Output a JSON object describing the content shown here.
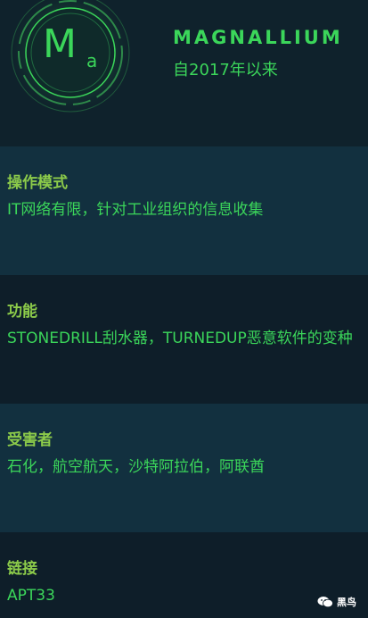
{
  "header": {
    "badge_symbol": "M",
    "badge_sub": "a",
    "name": "MAGNALLIUM",
    "since": "自2017年以来"
  },
  "sections": [
    {
      "label": "操作模式",
      "value": "IT网络有限，针对工业组织的信息收集"
    },
    {
      "label": "功能",
      "value": "STONEDRILL刮水器，TURNEDUP恶意软件的变种"
    },
    {
      "label": "受害者",
      "value": "石化，航空航天，沙特阿拉伯，阿联酋"
    },
    {
      "label": "链接",
      "value": "APT33"
    }
  ],
  "watermark": {
    "icon": "wechat-icon",
    "text": "黑鸟"
  },
  "colors": {
    "accent": "#3bd65a",
    "label": "#8ccb4a",
    "band_light": "#12303f",
    "band_dark": "#0e1e29"
  }
}
